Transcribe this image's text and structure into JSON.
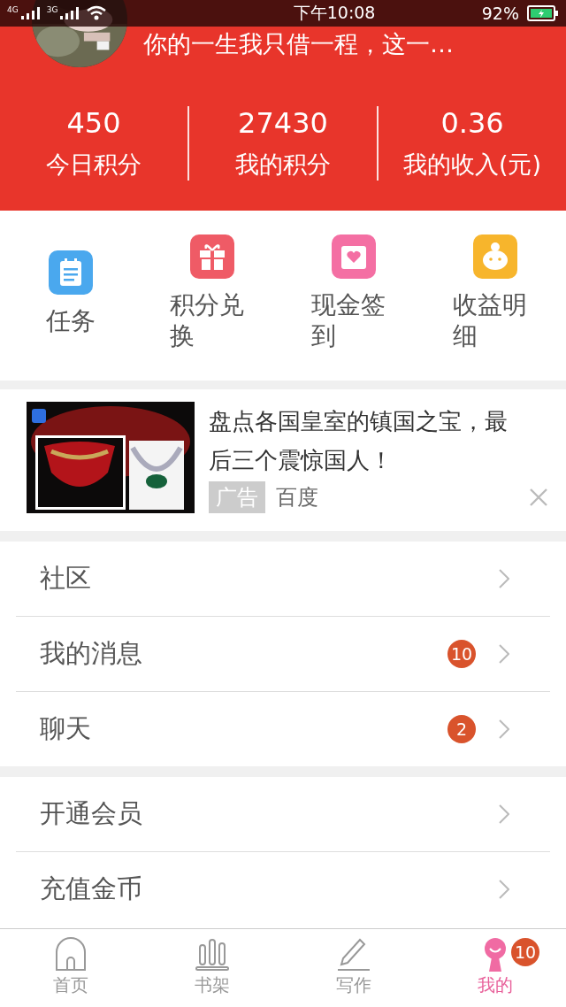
{
  "status_bar": {
    "network_1": "4G",
    "network_2": "3G",
    "time": "下午10:08",
    "battery": "92%"
  },
  "profile": {
    "motto": "你的一生我只借一程，这一…"
  },
  "stats": [
    {
      "value": "450",
      "label": "今日积分"
    },
    {
      "value": "27430",
      "label": "我的积分"
    },
    {
      "value": "0.36",
      "label": "我的收入(元)"
    }
  ],
  "shortcuts": [
    {
      "label": "任务",
      "kind": "task"
    },
    {
      "label": "积分兑换",
      "kind": "gift"
    },
    {
      "label": "现金签到",
      "kind": "checkin"
    },
    {
      "label": "收益明细",
      "kind": "income"
    }
  ],
  "ad": {
    "headline": "盘点各国皇室的镇国之宝，最后三个震惊国人！",
    "tag": "广告",
    "source": "百度"
  },
  "menu_groups": [
    [
      {
        "label": "社区"
      },
      {
        "label": "我的消息",
        "badge": "10"
      },
      {
        "label": "聊天",
        "badge": "2"
      }
    ],
    [
      {
        "label": "开通会员"
      },
      {
        "label": "充值金币"
      }
    ]
  ],
  "tab_bar": [
    {
      "label": "首页",
      "kind": "home",
      "selected": false
    },
    {
      "label": "书架",
      "kind": "shelf",
      "selected": false
    },
    {
      "label": "写作",
      "kind": "write",
      "selected": false
    },
    {
      "label": "我的",
      "kind": "me",
      "selected": true,
      "badge": "10"
    }
  ]
}
